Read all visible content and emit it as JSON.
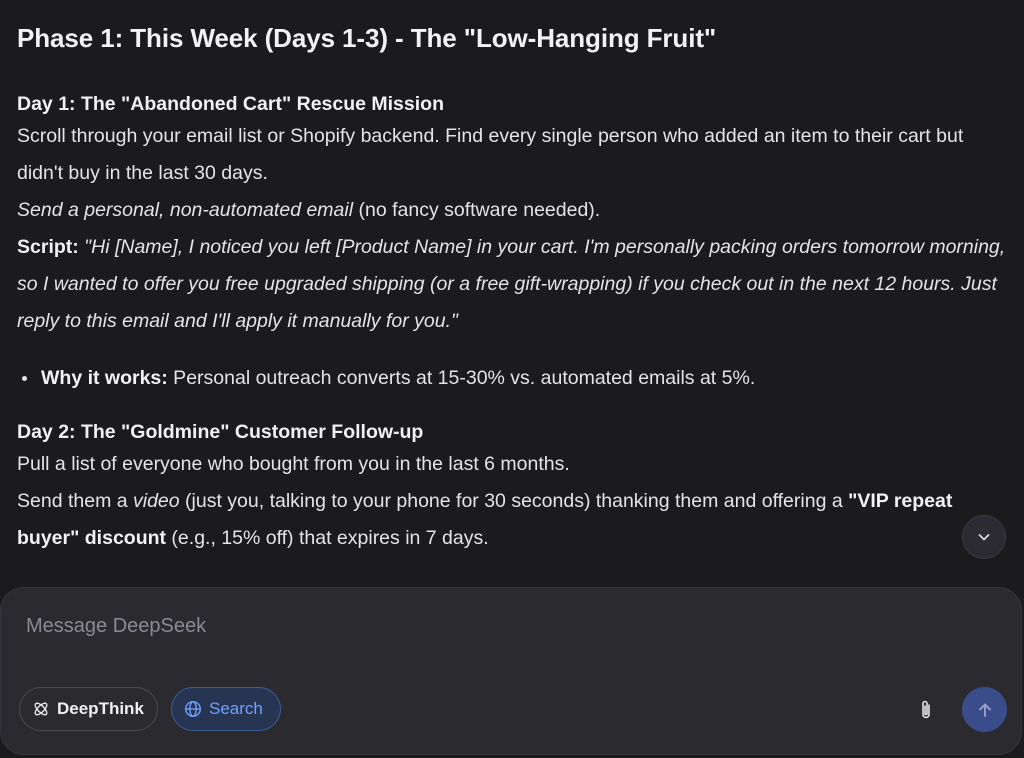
{
  "chat": {
    "phase_heading": "Phase 1: This Week (Days 1-3) - The \"Low-Hanging Fruit\"",
    "day1": {
      "title": "Day 1: The \"Abandoned Cart\" Rescue Mission",
      "line1": "Scroll through your email list or Shopify backend. Find every single person who added an item to their cart but didn't buy in the last 30 days.",
      "line2_em": "Send a personal, non-automated email",
      "line2_rest": " (no fancy software needed).",
      "script_label": "Script:",
      "script_text": " \"Hi [Name], I noticed you left [Product Name] in your cart. I'm personally packing orders tomorrow morning, so I wanted to offer you free upgraded shipping (or a free gift-wrapping) if you check out in the next 12 hours. Just reply to this email and I'll apply it manually for you.\"",
      "bullet_label": "Why it works:",
      "bullet_text": " Personal outreach converts at 15-30% vs. automated emails at 5%."
    },
    "day2": {
      "title": "Day 2: The \"Goldmine\" Customer Follow-up",
      "line1": "Pull a list of everyone who bought from you in the last 6 months.",
      "line2_a": "Send them a ",
      "line2_em": "video",
      "line2_b": " (just you, talking to your phone for 30 seconds) thanking them and offering a ",
      "line2_strong": "\"VIP repeat buyer\" discount",
      "line2_c": " (e.g., 15% off) that expires in 7 days."
    }
  },
  "composer": {
    "placeholder": "Message DeepSeek",
    "deepthink_label": "DeepThink",
    "search_label": "Search",
    "search_active": true,
    "accent_color": "#6ea0ff",
    "send_color": "#3b4c8a"
  },
  "icons": {
    "scroll": "chevron-down-icon",
    "deepthink": "atom-icon",
    "search": "globe-icon",
    "attach": "paperclip-icon",
    "send": "arrow-up-icon"
  }
}
